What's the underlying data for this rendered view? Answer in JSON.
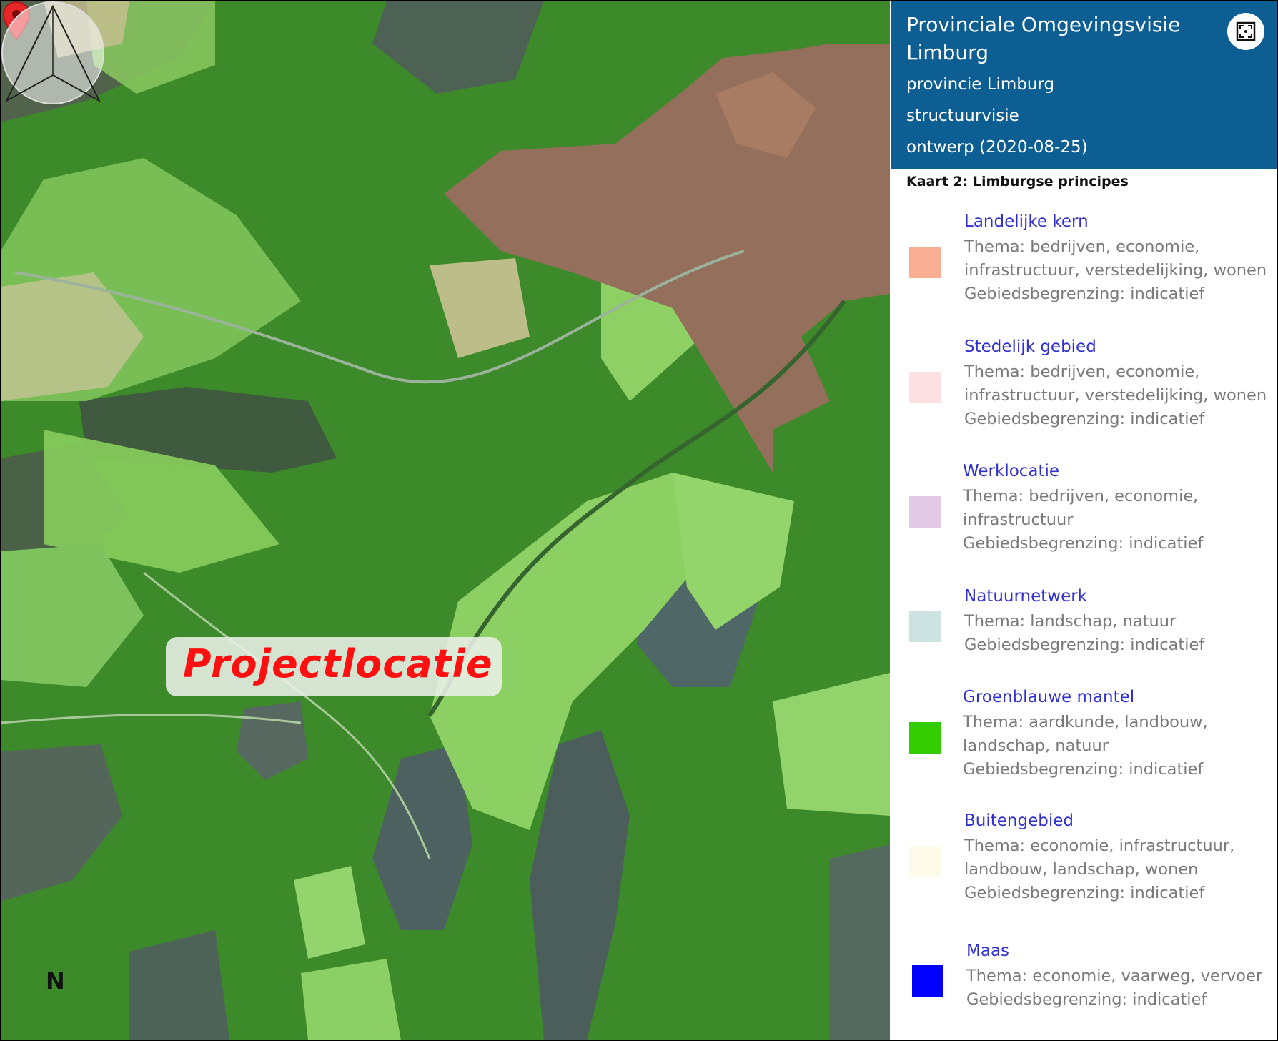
{
  "map": {
    "project_label": "Projectlocatie",
    "compass_label": "N"
  },
  "panel": {
    "title": "Provinciale Omgevingsvisie Limburg",
    "subtitle": "provincie Limburg",
    "type": "structuurvisie",
    "status": "ontwerp (2020-08-25)",
    "fullscreen_icon": "fullscreen-icon",
    "map_caption": "Kaart 2: Limburgse principes"
  },
  "legend": [
    {
      "name": "Landelijke kern",
      "desc": [
        "Thema: bedrijven, economie,",
        "infrastructuur, verstedelijking, wonen",
        "Gebiedsbegrenzing: indicatief"
      ],
      "color": "#f9ad92"
    },
    {
      "name": "Stedelijk gebied",
      "desc": [
        "Thema: bedrijven, economie,",
        "infrastructuur, verstedelijking, wonen",
        "Gebiedsbegrenzing: indicatief"
      ],
      "color": "#fde0e1"
    },
    {
      "name": "Werklocatie",
      "desc": [
        "Thema: bedrijven, economie,",
        "infrastructuur",
        "Gebiedsbegrenzing: indicatief"
      ],
      "color": "#e2c9e4"
    },
    {
      "name": "Natuurnetwerk",
      "desc": [
        "Thema: landschap, natuur",
        "Gebiedsbegrenzing: indicatief"
      ],
      "color": "#cde3e2"
    },
    {
      "name": "Groenblauwe mantel",
      "desc": [
        "Thema: aardkunde, landbouw,",
        "landschap, natuur",
        "Gebiedsbegrenzing: indicatief"
      ],
      "color": "#33cc00"
    },
    {
      "name": "Buitengebied",
      "desc": [
        "Thema: economie, infrastructuur,",
        "landbouw, landschap, wonen",
        "Gebiedsbegrenzing: indicatief"
      ],
      "color": "#fefbea"
    },
    {
      "name": "Maas",
      "desc": [
        "Thema: economie, vaarweg, vervoer",
        "Gebiedsbegrenzing: indicatief"
      ],
      "color": "#0000ff"
    }
  ]
}
